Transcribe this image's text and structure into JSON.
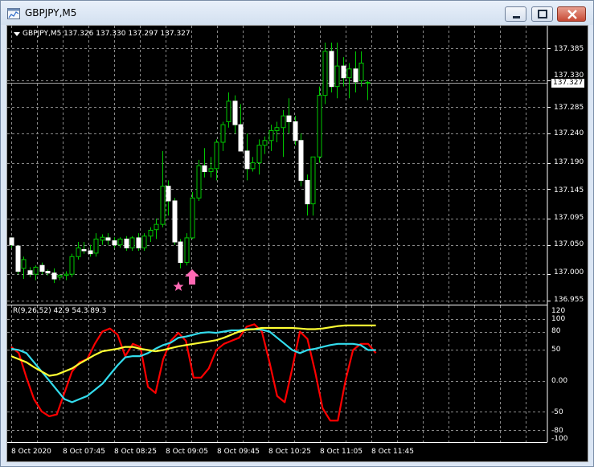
{
  "window": {
    "title": "GBPJPY,M5",
    "icon": "chart-window-icon",
    "buttons": [
      "minimize-icon",
      "restore-icon",
      "close-icon"
    ]
  },
  "chart": {
    "header": "GBPJPY,M5  137.326 137.330 137.297 137.327",
    "current_price": "137.327",
    "price_axis": [
      "137.385",
      "137.330",
      "137.285",
      "137.240",
      "137.190",
      "137.145",
      "137.095",
      "137.050",
      "137.000",
      "136.955"
    ],
    "time_axis": [
      "8 Oct 2020",
      "8 Oct 07:45",
      "8 Oct 08:25",
      "8 Oct 09:05",
      "8 Oct 09:45",
      "8 Oct 10:25",
      "8 Oct 11:05",
      "8 Oct 11:45"
    ],
    "bull_color": "#00c800",
    "bear_color": "#ffffff",
    "arrow_color": "#ff69b4"
  },
  "indicator": {
    "header": "R(9,26,52) 42.9 54.3 89.3",
    "axis": [
      "120",
      "100",
      "80",
      "50",
      "0.00",
      "-50",
      "-80",
      "-100"
    ],
    "line_colors": {
      "fast": "#ff0000",
      "medium": "#33ddee",
      "slow": "#ffff33"
    }
  },
  "chart_data": {
    "type": "line",
    "title": "",
    "xlabel": "",
    "ylabel": "",
    "price_ylim": [
      136.955,
      137.41
    ],
    "indicator_ylim": [
      -100,
      120
    ],
    "candles": [
      [
        137.062,
        137.063,
        137.045,
        137.05
      ],
      [
        137.048,
        137.049,
        137.0,
        137.005
      ],
      [
        137.01,
        137.03,
        136.992,
        137.025
      ],
      [
        137.006,
        137.012,
        136.995,
        137.0
      ],
      [
        137.0,
        137.015,
        136.99,
        137.012
      ],
      [
        137.015,
        137.02,
        137.0,
        137.005
      ],
      [
        137.005,
        137.008,
        136.998,
        137.002
      ],
      [
        137.002,
        137.01,
        136.985,
        136.992
      ],
      [
        136.995,
        137.0,
        136.99,
        136.998
      ],
      [
        136.998,
        137.005,
        136.99,
        137.0
      ],
      [
        137.0,
        137.035,
        136.995,
        137.03
      ],
      [
        137.03,
        137.055,
        137.025,
        137.045
      ],
      [
        137.042,
        137.055,
        137.035,
        137.04
      ],
      [
        137.04,
        137.05,
        137.03,
        137.035
      ],
      [
        137.036,
        137.07,
        137.03,
        137.06
      ],
      [
        137.058,
        137.068,
        137.05,
        137.063
      ],
      [
        137.062,
        137.07,
        137.05,
        137.058
      ],
      [
        137.057,
        137.063,
        137.045,
        137.05
      ],
      [
        137.05,
        137.063,
        137.045,
        137.06
      ],
      [
        137.06,
        137.065,
        137.04,
        137.045
      ],
      [
        137.045,
        137.065,
        137.04,
        137.062
      ],
      [
        137.062,
        137.07,
        137.04,
        137.045
      ],
      [
        137.045,
        137.07,
        137.04,
        137.065
      ],
      [
        137.065,
        137.08,
        137.055,
        137.075
      ],
      [
        137.076,
        137.095,
        137.06,
        137.085
      ],
      [
        137.085,
        137.21,
        137.08,
        137.15
      ],
      [
        137.15,
        137.16,
        137.1,
        137.125
      ],
      [
        137.125,
        137.13,
        137.05,
        137.055
      ],
      [
        137.055,
        137.06,
        137.01,
        137.02
      ],
      [
        137.02,
        137.07,
        137.015,
        137.062
      ],
      [
        137.062,
        137.14,
        137.06,
        137.13
      ],
      [
        137.13,
        137.195,
        137.125,
        137.185
      ],
      [
        137.185,
        137.215,
        137.165,
        137.175
      ],
      [
        137.175,
        137.2,
        137.165,
        137.18
      ],
      [
        137.18,
        137.23,
        137.16,
        137.225
      ],
      [
        137.225,
        137.26,
        137.21,
        137.255
      ],
      [
        137.26,
        137.31,
        137.25,
        137.295
      ],
      [
        137.295,
        137.305,
        137.24,
        137.255
      ],
      [
        137.255,
        137.29,
        137.22,
        137.21
      ],
      [
        137.21,
        137.24,
        137.16,
        137.18
      ],
      [
        137.18,
        137.2,
        137.175,
        137.19
      ],
      [
        137.19,
        137.23,
        137.17,
        137.22
      ],
      [
        137.22,
        137.235,
        137.205,
        137.228
      ],
      [
        137.228,
        137.255,
        137.21,
        137.245
      ],
      [
        137.245,
        137.26,
        137.225,
        137.25
      ],
      [
        137.25,
        137.28,
        137.2,
        137.27
      ],
      [
        137.27,
        137.3,
        137.24,
        137.26
      ],
      [
        137.26,
        137.27,
        137.22,
        137.228
      ],
      [
        137.228,
        137.24,
        137.15,
        137.16
      ],
      [
        137.16,
        137.17,
        137.1,
        137.12
      ],
      [
        137.12,
        137.15,
        137.1,
        137.2
      ],
      [
        137.2,
        137.32,
        137.19,
        137.305
      ],
      [
        137.305,
        137.395,
        137.29,
        137.38
      ],
      [
        137.38,
        137.395,
        137.31,
        137.32
      ],
      [
        137.32,
        137.395,
        137.3,
        137.355
      ],
      [
        137.355,
        137.37,
        137.32,
        137.335
      ],
      [
        137.335,
        137.36,
        137.3,
        137.35
      ],
      [
        137.35,
        137.38,
        137.31,
        137.328
      ],
      [
        137.33,
        137.38,
        137.32,
        137.36
      ],
      [
        137.326,
        137.33,
        137.297,
        137.327
      ]
    ],
    "series": [
      {
        "name": "",
        "color": "#ff0000",
        "values": [
          55,
          45,
          5,
          -30,
          -50,
          -58,
          -55,
          -20,
          15,
          30,
          35,
          60,
          80,
          85,
          75,
          40,
          60,
          55,
          -10,
          -20,
          35,
          65,
          78,
          65,
          5,
          5,
          20,
          50,
          60,
          65,
          70,
          88,
          92,
          80,
          30,
          -25,
          -35,
          20,
          80,
          68,
          15,
          -45,
          -65,
          -65,
          0,
          50,
          60,
          60,
          45
        ]
      },
      {
        "name": "",
        "color": "#33ddee",
        "values": [
          52,
          50,
          45,
          30,
          15,
          0,
          -15,
          -30,
          -35,
          -30,
          -25,
          -15,
          -5,
          10,
          25,
          38,
          40,
          40,
          45,
          52,
          58,
          62,
          70,
          72,
          75,
          78,
          79,
          78,
          80,
          82,
          82,
          84,
          84,
          83,
          80,
          70,
          60,
          50,
          45,
          50,
          52,
          55,
          58,
          60,
          60,
          60,
          58,
          50,
          50
        ]
      },
      {
        "name": "",
        "color": "#ffff33",
        "values": [
          40,
          35,
          30,
          22,
          15,
          8,
          10,
          15,
          20,
          28,
          35,
          42,
          48,
          50,
          52,
          55,
          55,
          52,
          50,
          48,
          50,
          53,
          56,
          58,
          60,
          62,
          64,
          66,
          70,
          75,
          80,
          83,
          84,
          86,
          86,
          86,
          86,
          86,
          85,
          84,
          84,
          85,
          87,
          89,
          90,
          90,
          90,
          90,
          90
        ]
      }
    ]
  }
}
